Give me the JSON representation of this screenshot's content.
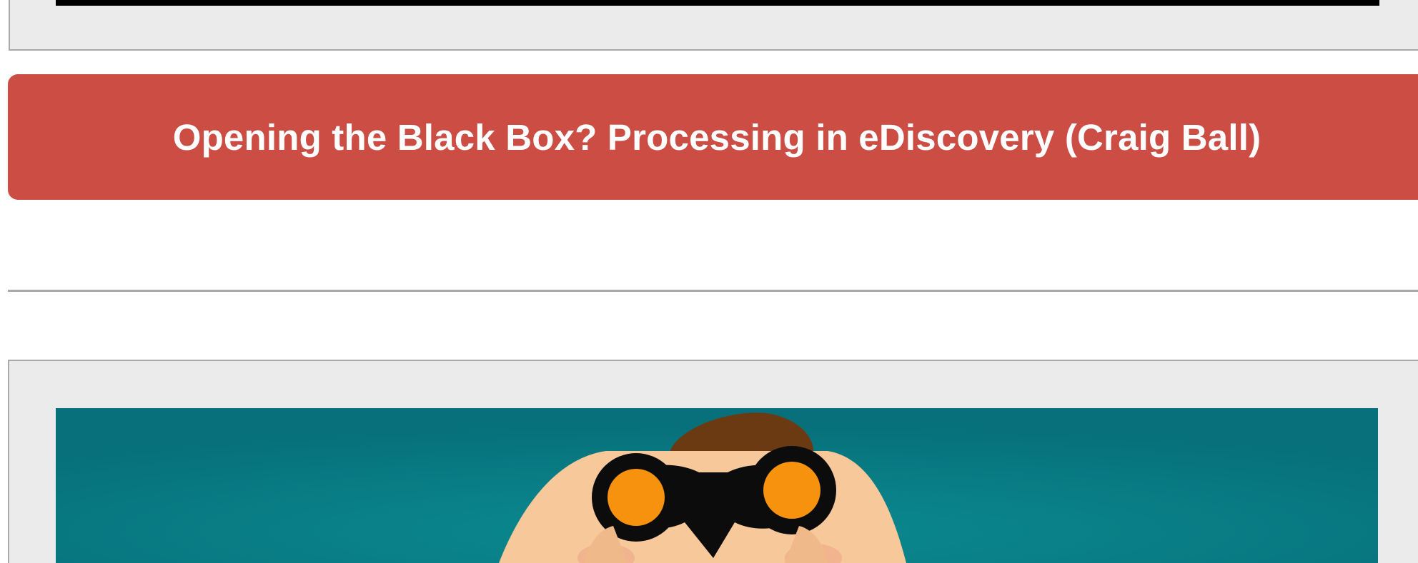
{
  "article": {
    "title": "Opening the Black Box? Processing in eDiscovery (Craig Ball)"
  },
  "illustration": {
    "subject": "person-with-binoculars",
    "colors": {
      "background": "#0a7f86",
      "skin": "#f7c89a",
      "hair": "#6b3a12",
      "binoculars": "#0c0c0c",
      "lens": "#f7920e"
    }
  },
  "colors": {
    "button_red": "#cc4d44",
    "panel_gray": "#ebebeb",
    "border_gray": "#a9a9a9"
  }
}
